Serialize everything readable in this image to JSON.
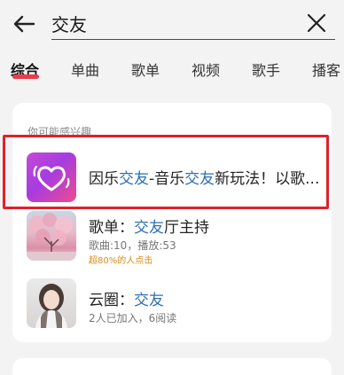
{
  "search": {
    "query": "交友"
  },
  "tabs": [
    {
      "label": "综合"
    },
    {
      "label": "单曲"
    },
    {
      "label": "歌单"
    },
    {
      "label": "视频"
    },
    {
      "label": "歌手"
    },
    {
      "label": "播客"
    }
  ],
  "section": {
    "title": "你可能感兴趣"
  },
  "results": [
    {
      "title_parts": [
        "因乐",
        "交友",
        "-音乐",
        "交友",
        "新玩法！以歌..."
      ]
    },
    {
      "title_prefix": "歌单：",
      "title_highlight": "交友",
      "title_suffix": "厅主持",
      "sub": "歌曲:10，播放:53",
      "badge": "超80%的人点击"
    },
    {
      "title_prefix": "云圈：",
      "title_highlight": "交友",
      "sub": "2人已加入，6阅读"
    }
  ],
  "colors": {
    "accent": "#ec3b4a",
    "highlight_text": "#2c6fb3",
    "annotation_box": "#e0212b",
    "badge": "#d98b1a"
  },
  "icons": {
    "back": "arrow-left-icon",
    "clear": "close-icon",
    "app": "heart-app-icon"
  }
}
